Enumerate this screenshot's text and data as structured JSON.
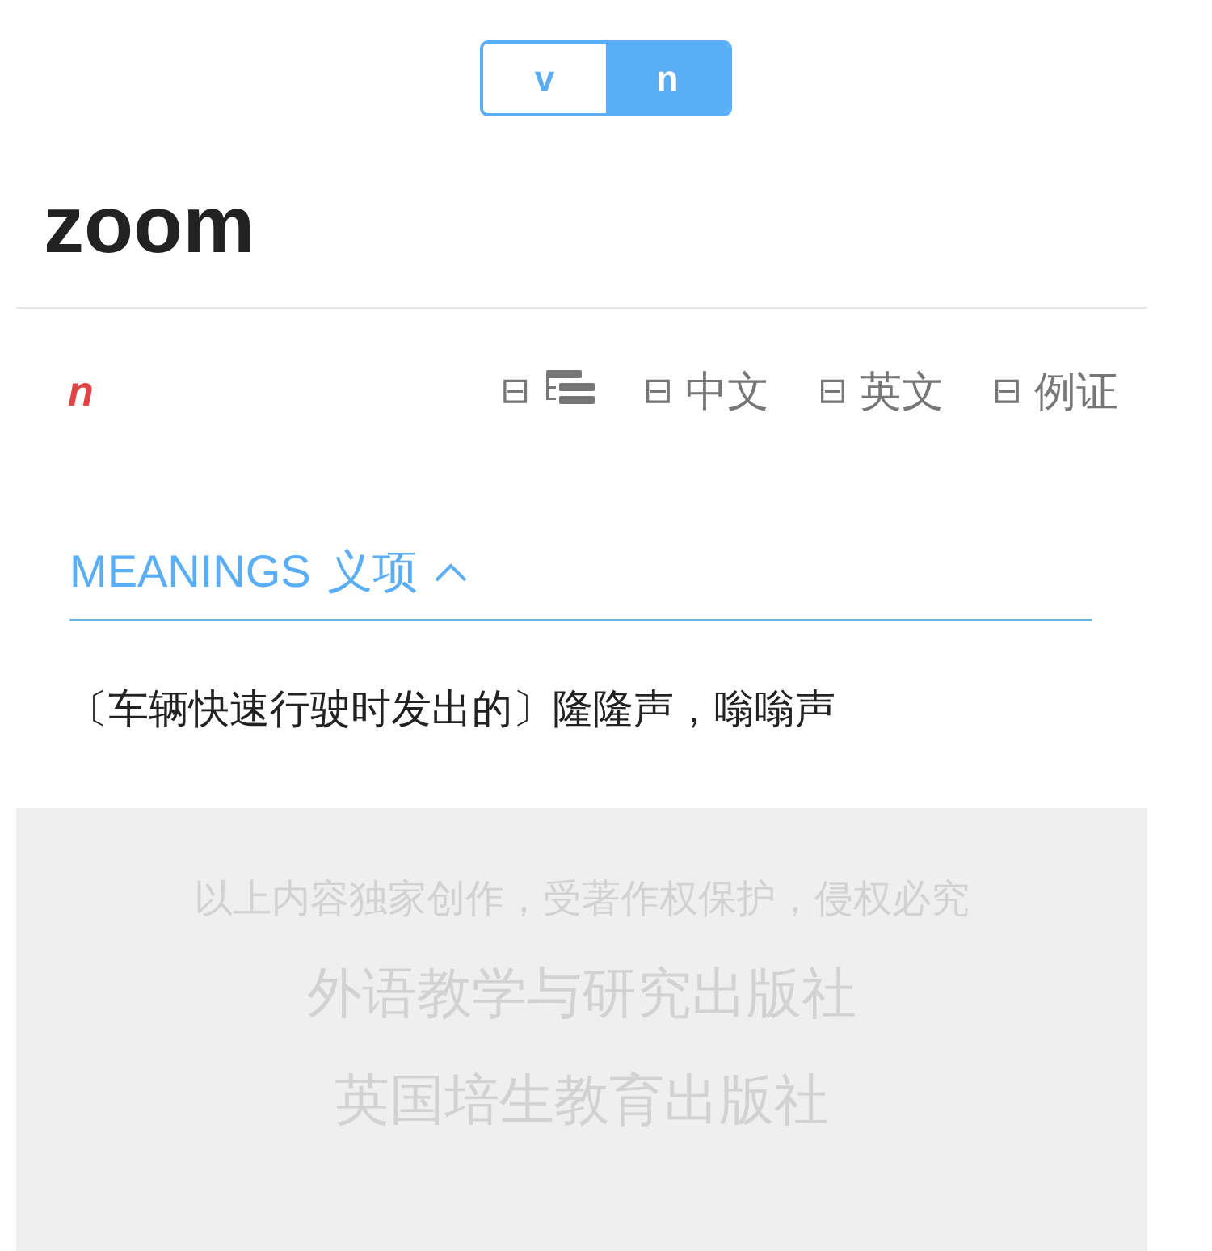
{
  "pos_tabs": [
    {
      "label": "v",
      "selected": false
    },
    {
      "label": "n",
      "selected": true
    }
  ],
  "headword": "zoom",
  "part_of_speech": "n",
  "toggles": [
    {
      "kind": "tree",
      "symbol": "⊟"
    },
    {
      "kind": "text",
      "symbol": "⊟",
      "label": "中文"
    },
    {
      "kind": "text",
      "symbol": "⊟",
      "label": "英文"
    },
    {
      "kind": "text",
      "symbol": "⊟",
      "label": "例证"
    }
  ],
  "section": {
    "title": "MEANINGS",
    "title_cn": "义项"
  },
  "meanings": [
    "〔车辆快速行驶时发出的〕隆隆声，嗡嗡声"
  ],
  "footer": {
    "notice": "以上内容独家创作，受著作权保护，侵权必究",
    "publishers": [
      "外语教学与研究出版社",
      "英国培生教育出版社"
    ]
  }
}
